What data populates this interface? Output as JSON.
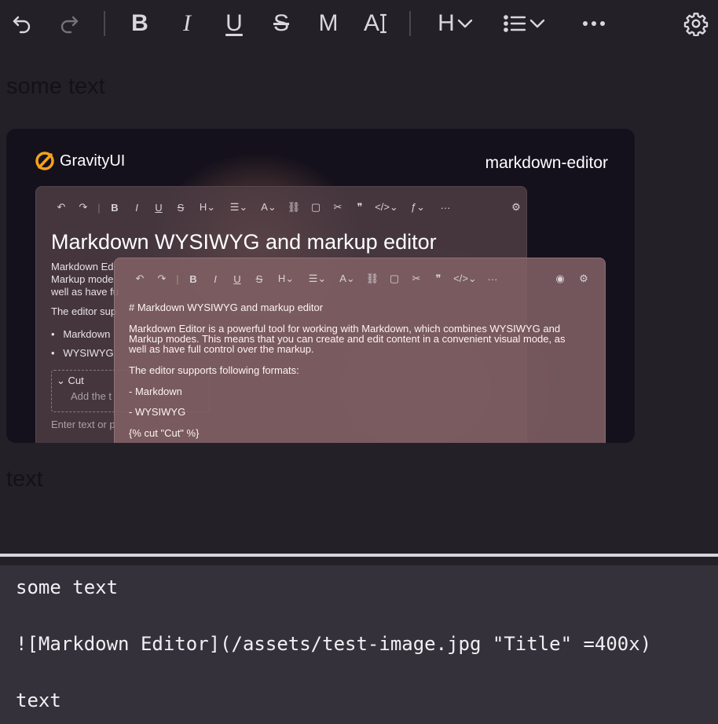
{
  "toolbar": {
    "bold_label": "B",
    "italic_label": "I",
    "underline_label": "U",
    "strike_label": "S",
    "mono_label": "M",
    "text_label": "A",
    "heading_label": "H"
  },
  "content": {
    "paragraph1": "some text",
    "paragraph2": "text"
  },
  "image": {
    "brand": "GravityUI",
    "product": "markdown-editor",
    "window1": {
      "title": "Markdown WYSIWYG and markup editor",
      "line1": "Markdown Ed",
      "line2": "Markup mode",
      "line3": "well as have fu",
      "line4": "The editor sup",
      "bullet1": "Markdown",
      "bullet2": "WYSIWYG",
      "cut_label": "Cut",
      "cut_hint": "Add the t",
      "placeholder": "Enter text or p"
    },
    "window2": {
      "heading": "# Markdown WYSIWYG and markup editor",
      "desc1": "Markdown Editor is a powerful tool for working with Markdown, which combines WYSIWYG and",
      "desc2": "Markup modes. This means that you can create and edit content in a convenient visual mode, as",
      "desc3": "well as have full control over the markup.",
      "formats": "The editor supports following formats:",
      "item1": "- Markdown",
      "item2": "- WYSIWYG",
      "cut": "{% cut \"Cut\" %}"
    }
  },
  "source": {
    "line1": "some text",
    "line2": "![Markdown Editor](/assets/test-image.jpg \"Title\" =400x)",
    "line3": "text"
  },
  "icons": [
    "undo-icon",
    "redo-icon",
    "bold-icon",
    "italic-icon",
    "underline-icon",
    "strikethrough-icon",
    "mono-icon",
    "text-color-icon",
    "heading-icon",
    "list-icon",
    "more-icon",
    "settings-icon"
  ]
}
